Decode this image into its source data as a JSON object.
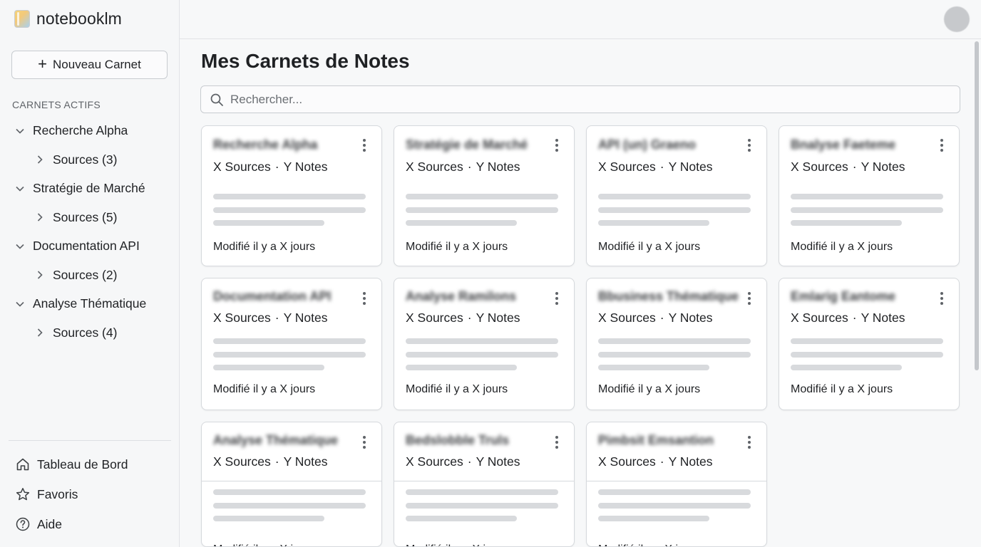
{
  "app": {
    "name": "notebooklm"
  },
  "sidebar": {
    "new_button_label": "Nouveau Carnet",
    "section_label": "CARNETS ACTIFS",
    "tree": [
      {
        "label": "Recherche Alpha",
        "sources": "Sources (3)"
      },
      {
        "label": "Stratégie de Marché",
        "sources": "Sources (5)"
      },
      {
        "label": "Documentation API",
        "sources": "Sources (2)"
      },
      {
        "label": "Analyse Thématique",
        "sources": "Sources (4)"
      }
    ],
    "bottom_nav": [
      {
        "label": "Tableau de Bord",
        "icon": "home-icon"
      },
      {
        "label": "Favoris",
        "icon": "star-icon"
      },
      {
        "label": "Aide",
        "icon": "help-icon"
      }
    ]
  },
  "main": {
    "title": "Mes Carnets de Notes",
    "search_placeholder": "Rechercher...",
    "cards": [
      {
        "title": "Recherche Alpha",
        "sources": "X Sources",
        "notes": "Y Notes",
        "modified": "Modifié il y a X jours"
      },
      {
        "title": "Stratégie de Marché",
        "sources": "X Sources",
        "notes": "Y Notes",
        "modified": "Modifié il y a X jours"
      },
      {
        "title": "API (un) Graeno",
        "sources": "X Sources",
        "notes": "Y Notes",
        "modified": "Modifié il y a X jours"
      },
      {
        "title": "Bnalyse Faeteme",
        "sources": "X Sources",
        "notes": "Y Notes",
        "modified": "Modifié il y a X jours"
      },
      {
        "title": "Documentation API",
        "sources": "X Sources",
        "notes": "Y Notes",
        "modified": "Modifié il y a X jours"
      },
      {
        "title": "Analyse Ramilons",
        "sources": "X Sources",
        "notes": "Y Notes",
        "modified": "Modifié il y a X jours"
      },
      {
        "title": "Bbusiness Thématique",
        "sources": "X Sources",
        "notes": "Y Notes",
        "modified": "Modifié il y a X jours"
      },
      {
        "title": "Emlarig Eantome",
        "sources": "X Sources",
        "notes": "Y Notes",
        "modified": "Modifié il y a X jours"
      },
      {
        "title": "Analyse Thématique",
        "sources": "X Sources",
        "notes": "Y Notes",
        "modified": "Modifié il y a X jours"
      },
      {
        "title": "Bedslobble Truls",
        "sources": "X Sources",
        "notes": "Y Notes",
        "modified": "Modifié il y a X jours"
      },
      {
        "title": "Pimbsit Emsantion",
        "sources": "X Sources",
        "notes": "Y Notes",
        "modified": "Modifié il y a X jours"
      }
    ]
  }
}
